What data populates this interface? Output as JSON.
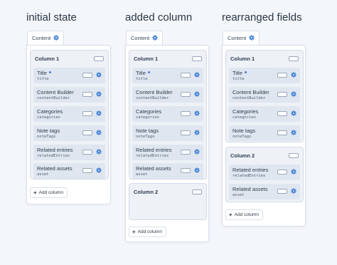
{
  "panels": [
    {
      "heading": "initial state",
      "tab_label": "Content",
      "columns": [
        {
          "title": "Column 1",
          "fields": [
            {
              "name": "Title",
              "handle": "title",
              "required": true
            },
            {
              "name": "Content Builder",
              "handle": "contentBuilder",
              "required": false
            },
            {
              "name": "Categories",
              "handle": "categories",
              "required": false
            },
            {
              "name": "Note tags",
              "handle": "noteTags",
              "required": false
            },
            {
              "name": "Related entries",
              "handle": "relatedEntries",
              "required": false
            },
            {
              "name": "Related assets",
              "handle": "asset",
              "required": false
            }
          ]
        }
      ],
      "add_column_label": "Add column"
    },
    {
      "heading": "added column",
      "tab_label": "Content",
      "columns": [
        {
          "title": "Column 1",
          "fields": [
            {
              "name": "Title",
              "handle": "title",
              "required": true
            },
            {
              "name": "Content Builder",
              "handle": "contentBuilder",
              "required": false
            },
            {
              "name": "Categories",
              "handle": "categories",
              "required": false
            },
            {
              "name": "Note tags",
              "handle": "noteTags",
              "required": false
            },
            {
              "name": "Related entries",
              "handle": "relatedEntries",
              "required": false
            },
            {
              "name": "Related assets",
              "handle": "asset",
              "required": false
            }
          ]
        },
        {
          "title": "Column 2",
          "fields": []
        }
      ],
      "add_column_label": "Add column"
    },
    {
      "heading": "rearranged fields",
      "tab_label": "Content",
      "columns": [
        {
          "title": "Column 1",
          "fields": [
            {
              "name": "Title",
              "handle": "title",
              "required": true
            },
            {
              "name": "Content Builder",
              "handle": "contentBuilder",
              "required": false
            },
            {
              "name": "Categories",
              "handle": "categories",
              "required": false
            },
            {
              "name": "Note tags",
              "handle": "noteTags",
              "required": false
            }
          ]
        },
        {
          "title": "Column 2",
          "fields": [
            {
              "name": "Related entries",
              "handle": "relatedEntries",
              "required": false
            },
            {
              "name": "Related assets",
              "handle": "asset",
              "required": false
            }
          ]
        }
      ],
      "add_column_label": "Add column"
    }
  ],
  "icons": {
    "tab": "gear-icon",
    "field_settings": "gear-icon",
    "column_toggle": "toggle-icon",
    "add": "plus-icon"
  },
  "colors": {
    "accent": "#3f7fd6",
    "background": "#f3f6fa",
    "field_bg": "#dfe6f0",
    "column_bg": "#eef2f7"
  }
}
